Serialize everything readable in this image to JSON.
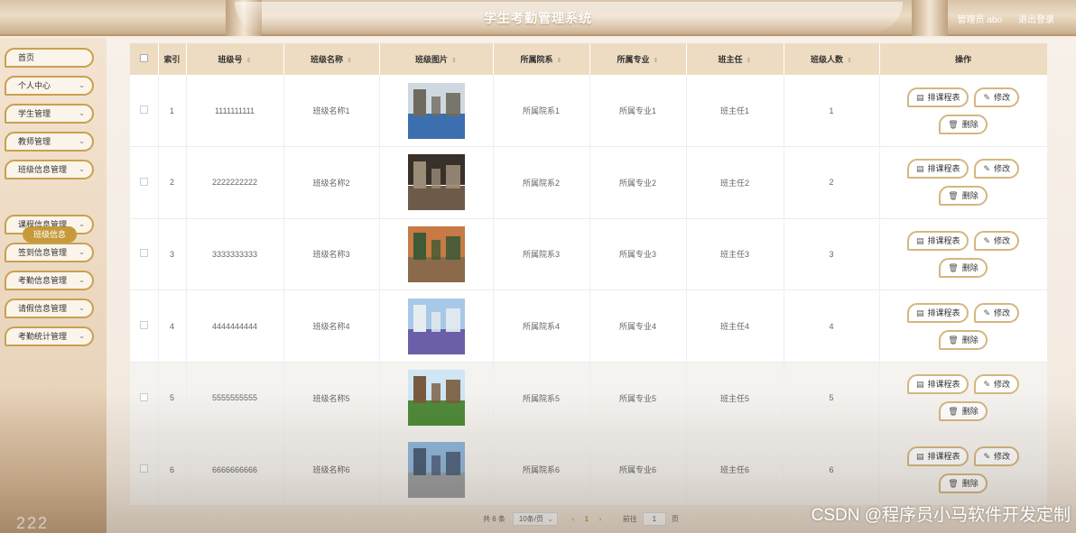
{
  "app": {
    "title": "学生考勤管理系统",
    "user": "管理员 abo",
    "logout": "退出登录"
  },
  "sidebar": {
    "items": [
      {
        "label": "首页",
        "has_chevron": false
      },
      {
        "label": "个人中心",
        "has_chevron": true
      },
      {
        "label": "学生管理",
        "has_chevron": true
      },
      {
        "label": "教师管理",
        "has_chevron": true
      },
      {
        "label": "班级信息管理",
        "has_chevron": true
      },
      {
        "label": "课程信息管理",
        "has_chevron": true
      },
      {
        "label": "签到信息管理",
        "has_chevron": true
      },
      {
        "label": "考勤信息管理",
        "has_chevron": true
      },
      {
        "label": "请假信息管理",
        "has_chevron": true
      },
      {
        "label": "考勤统计管理",
        "has_chevron": true
      }
    ],
    "active_sub": "班级信息",
    "footer": "222"
  },
  "table": {
    "headers": [
      "索引",
      "班级号",
      "班级名称",
      "班级图片",
      "所属院系",
      "所属专业",
      "班主任",
      "班级人数",
      "操作"
    ],
    "rows": [
      {
        "index": "1",
        "class_no": "1111111111",
        "class_name": "班级名称1",
        "dept": "所属院系1",
        "major": "所属专业1",
        "teacher": "班主任1",
        "count": "1"
      },
      {
        "index": "2",
        "class_no": "2222222222",
        "class_name": "班级名称2",
        "dept": "所属院系2",
        "major": "所属专业2",
        "teacher": "班主任2",
        "count": "2"
      },
      {
        "index": "3",
        "class_no": "3333333333",
        "class_name": "班级名称3",
        "dept": "所属院系3",
        "major": "所属专业3",
        "teacher": "班主任3",
        "count": "3"
      },
      {
        "index": "4",
        "class_no": "4444444444",
        "class_name": "班级名称4",
        "dept": "所属院系4",
        "major": "所属专业4",
        "teacher": "班主任4",
        "count": "4"
      },
      {
        "index": "5",
        "class_no": "5555555555",
        "class_name": "班级名称5",
        "dept": "所属院系5",
        "major": "所属专业5",
        "teacher": "班主任5",
        "count": "5"
      },
      {
        "index": "6",
        "class_no": "6666666666",
        "class_name": "班级名称6",
        "dept": "所属院系6",
        "major": "所属专业6",
        "teacher": "班主任6",
        "count": "6"
      }
    ],
    "actions": {
      "schedule": "排课程表",
      "edit": "修改",
      "delete": "删除"
    }
  },
  "pager": {
    "total": "共 6 条",
    "page_size": "10条/页",
    "current": "1",
    "goto": "前往",
    "jump_value": "1",
    "page_unit": "页"
  },
  "watermark": "CSDN @程序员小马软件开发定制",
  "colors": {
    "accent": "#c69a3b",
    "header_bg": "#eedcc2",
    "border_gold": "#c8a14f"
  },
  "icons": {
    "schedule": "list-icon",
    "edit": "edit-icon",
    "delete": "trash-icon"
  }
}
